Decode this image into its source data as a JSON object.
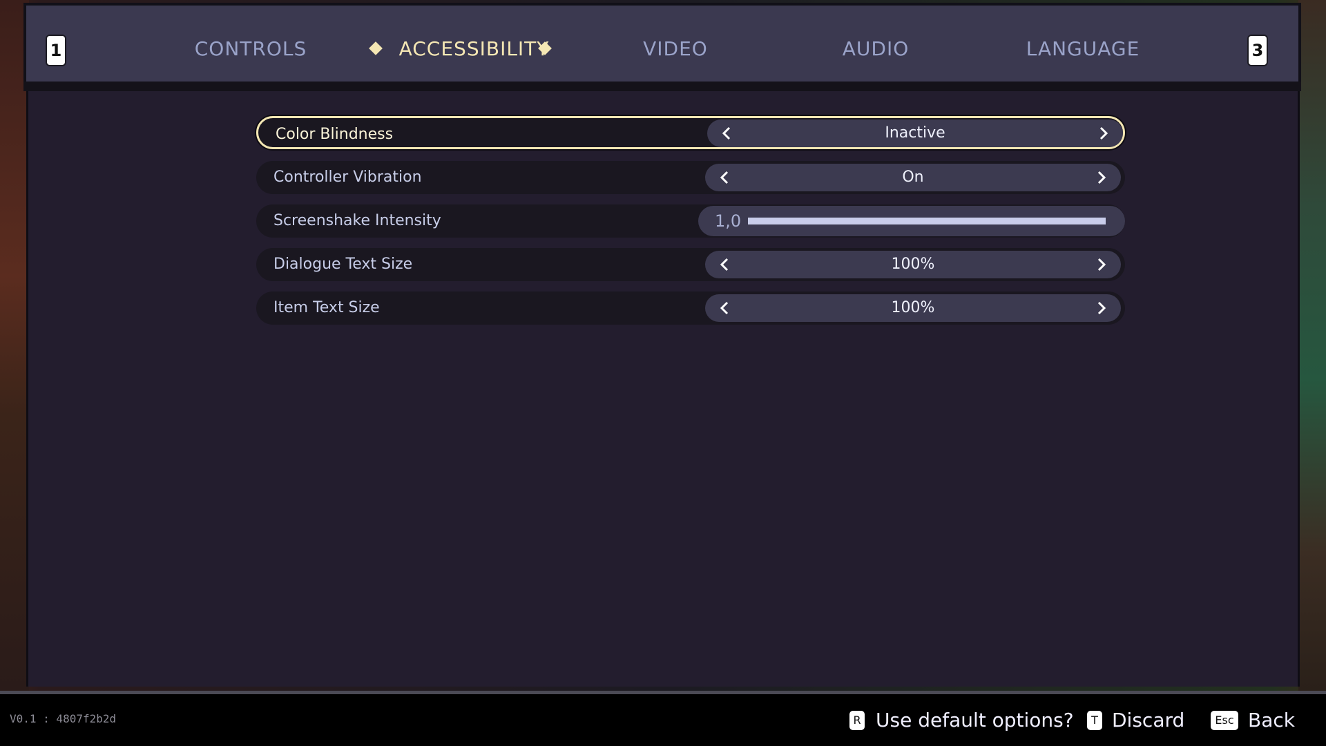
{
  "header": {
    "left_key": "1",
    "right_key": "3",
    "tabs": [
      {
        "label": "CONTROLS",
        "active": false
      },
      {
        "label": "ACCESSIBILITY",
        "active": true
      },
      {
        "label": "VIDEO",
        "active": false
      },
      {
        "label": "AUDIO",
        "active": false
      },
      {
        "label": "LANGUAGE",
        "active": false
      }
    ]
  },
  "settings": [
    {
      "label": "Color Blindness",
      "value": "Inactive",
      "kind": "selector",
      "selected": true
    },
    {
      "label": "Controller Vibration",
      "value": "On",
      "kind": "selector",
      "selected": false
    },
    {
      "label": "Screenshake Intensity",
      "value": "1,0",
      "kind": "slider",
      "fill_fraction": 1.0,
      "selected": false
    },
    {
      "label": "Dialogue Text Size",
      "value": "100%",
      "kind": "selector",
      "selected": false
    },
    {
      "label": "Item Text Size",
      "value": "100%",
      "kind": "selector",
      "selected": false
    }
  ],
  "footer": {
    "version": "V0.1 : 4807f2b2d",
    "hints": [
      {
        "key": "R",
        "label": "Use default options?"
      },
      {
        "key": "T",
        "label": "Discard"
      },
      {
        "key": "Esc",
        "label": "Back"
      }
    ]
  },
  "colors": {
    "accent": "#f5e7b4",
    "tab_inactive": "#9aa3c9",
    "panel": "#231d2e",
    "header": "#3b3950",
    "row": "#1a1720",
    "control": "#3c3a50"
  },
  "icons": [
    "chevron-left-icon",
    "chevron-right-icon",
    "diamond-icon"
  ]
}
